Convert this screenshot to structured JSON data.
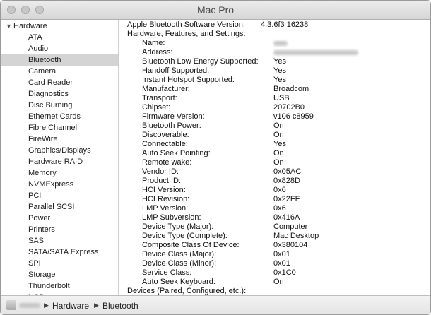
{
  "window": {
    "title": "Mac Pro",
    "traffic_lights": [
      "close-button",
      "minimize-button",
      "zoom-button"
    ]
  },
  "sidebar": {
    "group_label": "Hardware",
    "group_icon": "disclosure-triangle-down-icon",
    "items": [
      "ATA",
      "Audio",
      "Bluetooth",
      "Camera",
      "Card Reader",
      "Diagnostics",
      "Disc Burning",
      "Ethernet Cards",
      "Fibre Channel",
      "FireWire",
      "Graphics/Displays",
      "Hardware RAID",
      "Memory",
      "NVMExpress",
      "PCI",
      "Parallel SCSI",
      "Power",
      "Printers",
      "SAS",
      "SATA/SATA Express",
      "SPI",
      "Storage",
      "Thunderbolt",
      "USB"
    ],
    "selected": "Bluetooth"
  },
  "detail": {
    "software_version_label": "Apple Bluetooth Software Version:",
    "software_version_value": "4.3.6f3 16238",
    "section_label": "Hardware, Features, and Settings:",
    "rows": [
      {
        "label": "Name:",
        "value": ""
      },
      {
        "label": "Address:",
        "value": ""
      },
      {
        "label": "Bluetooth Low Energy Supported:",
        "value": "Yes"
      },
      {
        "label": "Handoff Supported:",
        "value": "Yes"
      },
      {
        "label": "Instant Hotspot Supported:",
        "value": "Yes"
      },
      {
        "label": "Manufacturer:",
        "value": "Broadcom"
      },
      {
        "label": "Transport:",
        "value": "USB"
      },
      {
        "label": "Chipset:",
        "value": "20702B0"
      },
      {
        "label": "Firmware Version:",
        "value": "v106 c8959"
      },
      {
        "label": "Bluetooth Power:",
        "value": "On"
      },
      {
        "label": "Discoverable:",
        "value": "On"
      },
      {
        "label": "Connectable:",
        "value": "Yes"
      },
      {
        "label": "Auto Seek Pointing:",
        "value": "On"
      },
      {
        "label": "Remote wake:",
        "value": "On"
      },
      {
        "label": "Vendor ID:",
        "value": "0x05AC"
      },
      {
        "label": "Product ID:",
        "value": "0x828D"
      },
      {
        "label": "HCI Version:",
        "value": "0x6"
      },
      {
        "label": "HCI Revision:",
        "value": "0x22FF"
      },
      {
        "label": "LMP Version:",
        "value": "0x6"
      },
      {
        "label": "LMP Subversion:",
        "value": "0x416A"
      },
      {
        "label": "Device Type (Major):",
        "value": "Computer"
      },
      {
        "label": "Device Type (Complete):",
        "value": "Mac Desktop"
      },
      {
        "label": "Composite Class Of Device:",
        "value": "0x380104"
      },
      {
        "label": "Device Class (Major):",
        "value": "0x01"
      },
      {
        "label": "Device Class (Minor):",
        "value": "0x01"
      },
      {
        "label": "Service Class:",
        "value": "0x1C0"
      },
      {
        "label": "Auto Seek Keyboard:",
        "value": "On"
      }
    ],
    "devices_label": "Devices (Paired, Configured, etc.):"
  },
  "pathbar": {
    "icon": "computer-icon",
    "crumbs": [
      "Hardware",
      "Bluetooth"
    ],
    "separator_icon": "path-separator-triangle-icon"
  }
}
